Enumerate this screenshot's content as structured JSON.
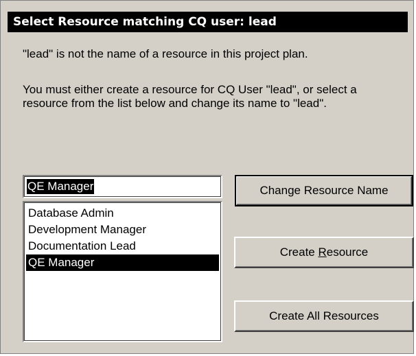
{
  "dialog": {
    "title": "Select Resource matching CQ user: lead",
    "message_line1": "\"lead\" is not the name of a resource in this project plan.",
    "message_line2": "You must either create a resource for CQ User \"lead\", or select a resource from the list below and change its name to \"lead\"."
  },
  "resource_name_field": {
    "value": "QE Manager"
  },
  "resource_list": {
    "items": [
      "Database Admin",
      "Development Manager",
      "Documentation Lead",
      "QE Manager"
    ],
    "selected": "QE Manager"
  },
  "buttons": {
    "change_name": "Change Resource Name",
    "create_resource_prefix": "Create ",
    "create_resource_mnemonic": "R",
    "create_resource_suffix": "esource",
    "create_all": "Create All Resources"
  }
}
